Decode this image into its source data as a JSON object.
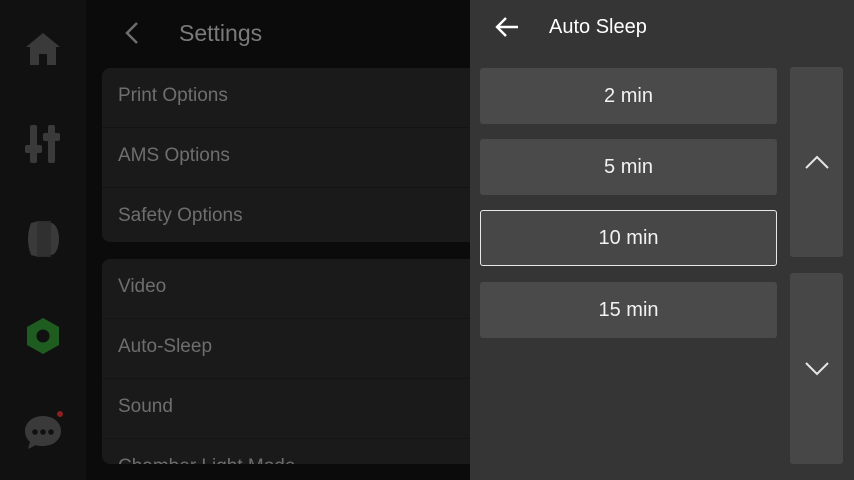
{
  "sidebar": {
    "icons": [
      {
        "name": "home-icon",
        "color": "#3a3a3a"
      },
      {
        "name": "tune-icon",
        "color": "#3a3a3a"
      },
      {
        "name": "filament-icon",
        "color": "#3a3a3a"
      },
      {
        "name": "settings-gear-icon",
        "color": "#1f5c1f"
      },
      {
        "name": "chat-icon",
        "color": "#3a3a3a",
        "badge_color": "#8a2020"
      }
    ]
  },
  "settings": {
    "title": "Settings",
    "groups": [
      {
        "items": [
          "Print Options",
          "AMS Options",
          "Safety Options"
        ]
      },
      {
        "items": [
          "Video",
          "Auto-Sleep",
          "Sound",
          "Chamber Light Mode"
        ]
      }
    ]
  },
  "auto_sleep": {
    "title": "Auto Sleep",
    "options": [
      "2 min",
      "5 min",
      "10 min",
      "15 min"
    ],
    "selected": "10 min",
    "accent_color": "#e8e8e8"
  }
}
